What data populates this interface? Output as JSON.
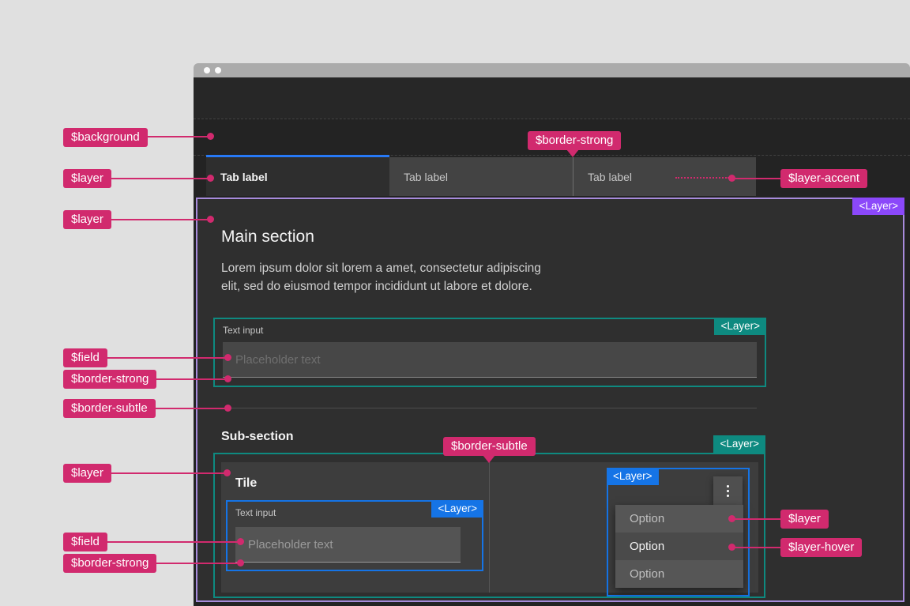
{
  "browser": {
    "window_controls": "two-dots"
  },
  "tabs": {
    "items": [
      {
        "label": "Tab label",
        "selected": true
      },
      {
        "label": "Tab label",
        "selected": false
      },
      {
        "label": "Tab label",
        "selected": false
      }
    ]
  },
  "main": {
    "heading": "Main section",
    "body_line1": "Lorem ipsum dolor sit lorem a amet, consectetur adipiscing",
    "body_line2": "elit, sed do eiusmod tempor incididunt ut labore et dolore.",
    "layer_badge": "<Layer>",
    "text_input": {
      "label": "Text input",
      "placeholder": "Placeholder text",
      "layer_badge": "<Layer>"
    },
    "subsection": {
      "heading": "Sub-section",
      "layer_badge": "<Layer>",
      "tile": {
        "heading": "Tile",
        "text_input": {
          "label": "Text input",
          "placeholder": "Placeholder text",
          "layer_badge": "<Layer>"
        },
        "dropdown": {
          "layer_badge": "<Layer>",
          "overflow_icon": "vertical-ellipsis",
          "options": [
            "Option",
            "Option",
            "Option"
          ]
        }
      }
    }
  },
  "annotations": {
    "background": "$background",
    "layer_tab": "$layer",
    "layer_main": "$layer",
    "field_main": "$field",
    "border_strong_main": "$border-strong",
    "border_subtle_main": "$border-subtle",
    "layer_tile": "$layer",
    "field_tile": "$field",
    "border_strong_tile": "$border-strong",
    "border_strong_tabs": "$border-strong",
    "border_subtle_tile": "$border-subtle",
    "layer_accent": "$layer-accent",
    "layer_menu": "$layer",
    "layer_hover_menu": "$layer-hover"
  },
  "colors": {
    "annotation_pink": "#d12a6e",
    "layer_badge_purple": "#8b48fa",
    "layer_badge_teal": "#0e8a80",
    "layer_badge_blue": "#1574e6",
    "tab_selected_accent": "#2779f6",
    "background_token": "#232323",
    "layer_token": "#2f2f2f"
  }
}
